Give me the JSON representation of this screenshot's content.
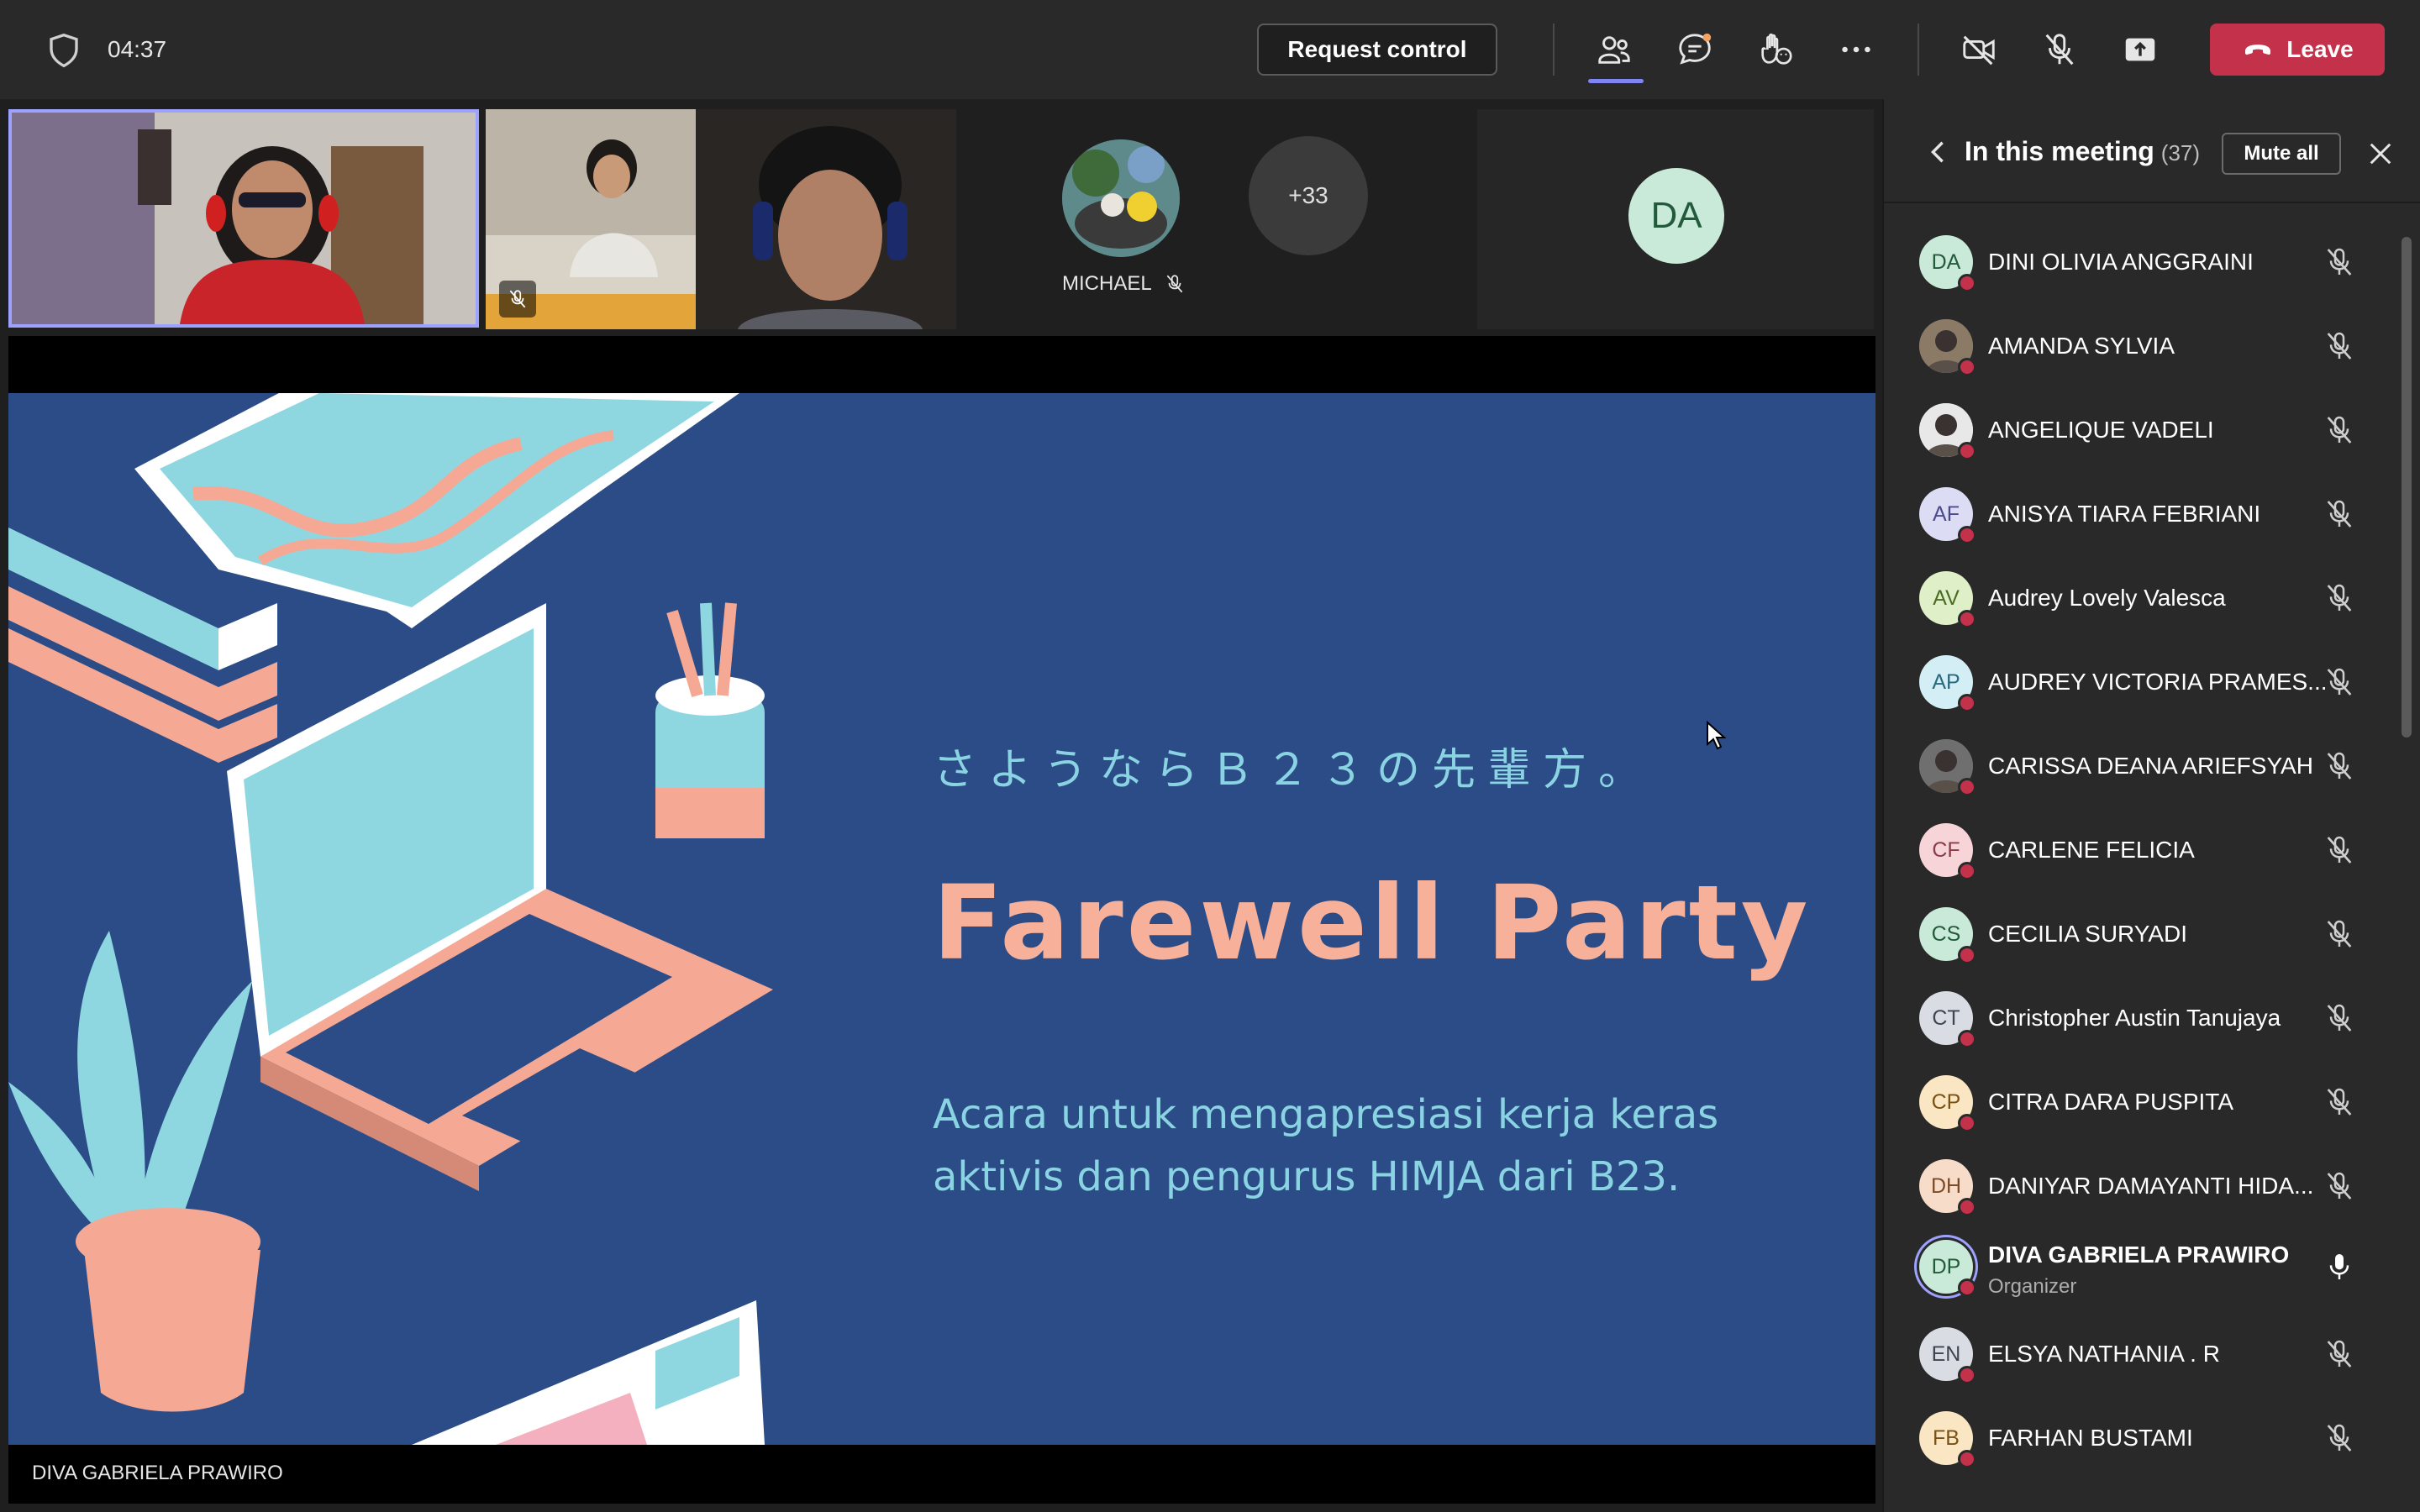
{
  "topbar": {
    "timer": "04:37",
    "request_control_label": "Request control",
    "leave_label": "Leave"
  },
  "stage": {
    "michael_label": "MICHAEL",
    "overflow_count": "+33",
    "da_initials": "DA",
    "presenter_name": "DIVA GABRIELA PRAWIRO"
  },
  "slide": {
    "japanese_line": "さようならＢ２３の先輩方。",
    "title": "Farewell Party",
    "subtitle_line1": "Acara untuk mengapresiasi kerja keras",
    "subtitle_line2": "aktivis dan pengurus HIMJA dari B23."
  },
  "panel": {
    "title": "In this meeting",
    "count": "(37)",
    "mute_all_label": "Mute all",
    "participants": [
      {
        "initials": "DA",
        "name": "DINI OLIVIA ANGGRAINI",
        "bg": "#c9ead8",
        "fg": "#235a3c",
        "photo": false,
        "mic": "muted"
      },
      {
        "initials": "",
        "name": "AMANDA SYLVIA",
        "bg": "#8a7a66",
        "fg": "#ffffff",
        "photo": true,
        "mic": "muted"
      },
      {
        "initials": "",
        "name": "ANGELIQUE VADELI",
        "bg": "#e8e8e8",
        "fg": "#333333",
        "photo": true,
        "mic": "muted"
      },
      {
        "initials": "AF",
        "name": "ANISYA TIARA FEBRIANI",
        "bg": "#dcdcf5",
        "fg": "#4b4b8c",
        "photo": false,
        "mic": "muted"
      },
      {
        "initials": "AV",
        "name": "Audrey Lovely Valesca",
        "bg": "#dff0c8",
        "fg": "#4a6b23",
        "photo": false,
        "mic": "muted"
      },
      {
        "initials": "AP",
        "name": "AUDREY VICTORIA PRAMES...",
        "bg": "#d4eef5",
        "fg": "#2a6a7d",
        "photo": false,
        "mic": "muted"
      },
      {
        "initials": "",
        "name": "CARISSA DEANA ARIEFSYAH",
        "bg": "#6f6f6f",
        "fg": "#ffffff",
        "photo": true,
        "mic": "muted"
      },
      {
        "initials": "CF",
        "name": "CARLENE FELICIA",
        "bg": "#f6d4d8",
        "fg": "#8c3b48",
        "photo": false,
        "mic": "muted"
      },
      {
        "initials": "CS",
        "name": "CECILIA SURYADI",
        "bg": "#c9ead8",
        "fg": "#235a3c",
        "photo": false,
        "mic": "muted"
      },
      {
        "initials": "CT",
        "name": "Christopher Austin Tanujaya",
        "bg": "#d9dde3",
        "fg": "#3d4550",
        "photo": false,
        "mic": "muted"
      },
      {
        "initials": "CP",
        "name": "CITRA DARA PUSPITA",
        "bg": "#fbe6c3",
        "fg": "#7a5216",
        "photo": false,
        "mic": "muted"
      },
      {
        "initials": "DH",
        "name": "DANIYAR DAMAYANTI HIDA...",
        "bg": "#f6dcc9",
        "fg": "#7d4a26",
        "photo": false,
        "mic": "muted"
      },
      {
        "initials": "DP",
        "name": "DIVA GABRIELA PRAWIRO",
        "role": "Organizer",
        "bg": "#c9ead8",
        "fg": "#235a3c",
        "photo": false,
        "mic": "on"
      },
      {
        "initials": "EN",
        "name": "ELSYA NATHANIA . R",
        "bg": "#d9dde3",
        "fg": "#3d4550",
        "photo": false,
        "mic": "muted"
      },
      {
        "initials": "FB",
        "name": "FARHAN BUSTAMI",
        "bg": "#fbe6c3",
        "fg": "#7a5216",
        "photo": false,
        "mic": "muted"
      }
    ]
  },
  "colors": {
    "accent": "#7f85f5",
    "leave": "#c4314b",
    "slide_bg": "#2b4c86",
    "slide_title": "#f7b19a",
    "slide_text": "#8ad3e2"
  }
}
